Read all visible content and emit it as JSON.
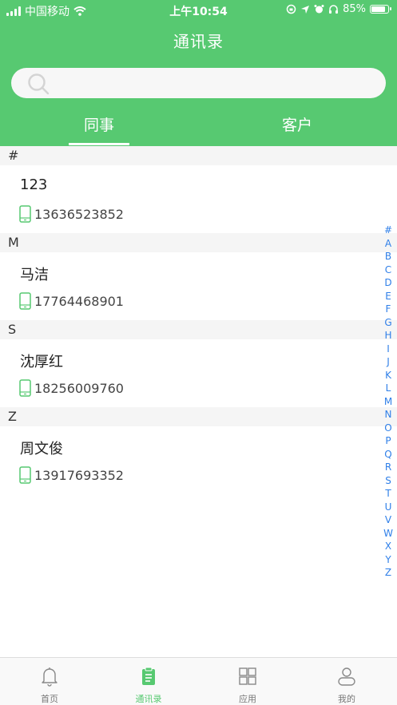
{
  "status_bar": {
    "carrier": "中国移动",
    "time": "上午10:54",
    "battery_text": "85%",
    "battery_level": 0.85
  },
  "header": {
    "title": "通讯录"
  },
  "search": {
    "placeholder": "",
    "value": "",
    "icon": "search-icon"
  },
  "tabs": [
    {
      "label": "同事",
      "active": true
    },
    {
      "label": "客户",
      "active": false
    }
  ],
  "sections": [
    {
      "letter": "#",
      "contacts": [
        {
          "name": "123",
          "phone": "13636523852"
        }
      ]
    },
    {
      "letter": "M",
      "contacts": [
        {
          "name": "马洁",
          "phone": "17764468901"
        }
      ]
    },
    {
      "letter": "S",
      "contacts": [
        {
          "name": "沈厚红",
          "phone": "18256009760"
        }
      ]
    },
    {
      "letter": "Z",
      "contacts": [
        {
          "name": "周文俊",
          "phone": "13917693352"
        }
      ]
    }
  ],
  "index_letters": [
    "#",
    "A",
    "B",
    "C",
    "D",
    "E",
    "F",
    "G",
    "H",
    "I",
    "J",
    "K",
    "L",
    "M",
    "N",
    "O",
    "P",
    "Q",
    "R",
    "S",
    "T",
    "U",
    "V",
    "W",
    "X",
    "Y",
    "Z"
  ],
  "tabbar": [
    {
      "label": "首页",
      "icon": "bell-icon",
      "active": false
    },
    {
      "label": "通讯录",
      "icon": "clipboard-icon",
      "active": true
    },
    {
      "label": "应用",
      "icon": "grid-icon",
      "active": false
    },
    {
      "label": "我的",
      "icon": "person-icon",
      "active": false
    }
  ],
  "colors": {
    "primary_green": "#57c971",
    "index_blue": "#2f7fe8",
    "section_bg": "#f5f5f5"
  }
}
